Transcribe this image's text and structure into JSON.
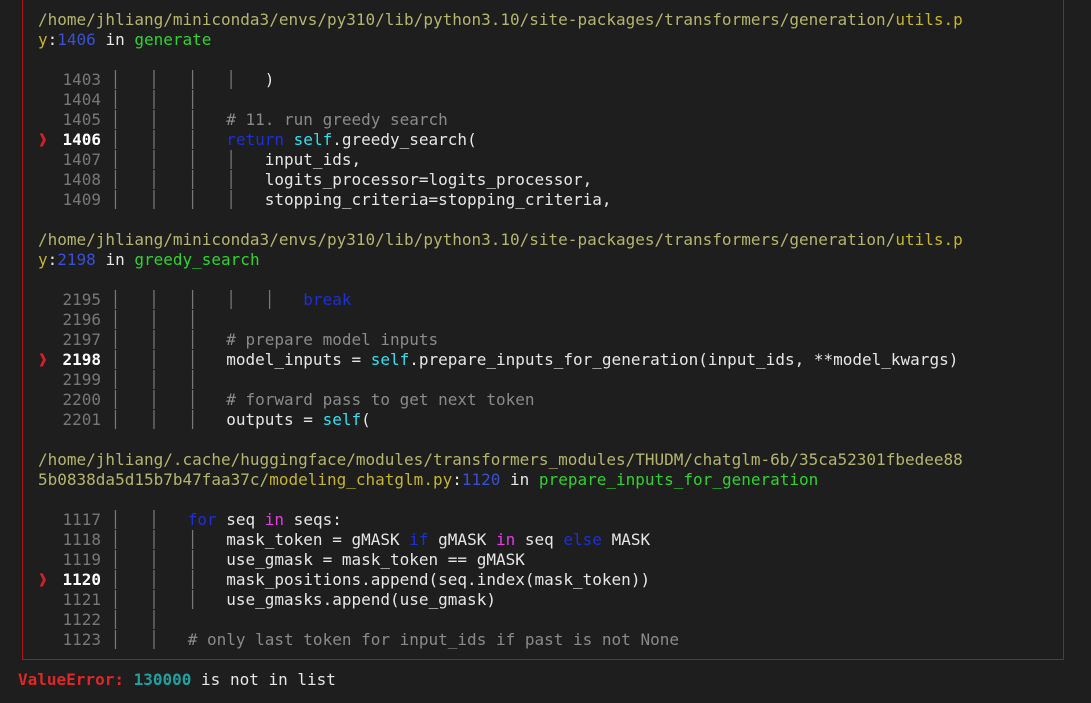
{
  "frames": [
    {
      "path_line1": "/home/jhliang/miniconda3/envs/py310/lib/python3.10/site-packages/transformers/generation/",
      "file_line1": "utils.p",
      "file_line2": "y",
      "colon": ":",
      "lineno": "1406",
      "in_word": " in ",
      "func": "generate",
      "lines": [
        {
          "n": "1403",
          "pipes": "│   │   │   │   ",
          "code": ")"
        },
        {
          "n": "1404",
          "pipes": "│   │   │   ",
          "code": ""
        },
        {
          "n": "1405",
          "pipes": "│   │   │   ",
          "comment": "# 11. run greedy search"
        },
        {
          "n": "1406",
          "pipes": "│   │   │   ",
          "kw": "return",
          "sp": " ",
          "self": "self",
          "code": ".greedy_search(",
          "current": true
        },
        {
          "n": "1407",
          "pipes": "│   │   │   │   ",
          "code": "input_ids,"
        },
        {
          "n": "1408",
          "pipes": "│   │   │   │   ",
          "code": "logits_processor=logits_processor,"
        },
        {
          "n": "1409",
          "pipes": "│   │   │   │   ",
          "code": "stopping_criteria=stopping_criteria,"
        }
      ]
    },
    {
      "path_line1": "/home/jhliang/miniconda3/envs/py310/lib/python3.10/site-packages/transformers/generation/",
      "file_line1": "utils.p",
      "file_line2": "y",
      "colon": ":",
      "lineno": "2198",
      "in_word": " in ",
      "func": "greedy_search",
      "lines": [
        {
          "n": "2195",
          "pipes": "│   │   │   │   │   ",
          "kw": "break"
        },
        {
          "n": "2196",
          "pipes": "│   │   │   ",
          "code": ""
        },
        {
          "n": "2197",
          "pipes": "│   │   │   ",
          "comment": "# prepare model inputs"
        },
        {
          "n": "2198",
          "pipes": "│   │   │   ",
          "code": "model_inputs = ",
          "self": "self",
          "code2": ".prepare_inputs_for_generation(input_ids, **model_kwargs)",
          "current": true
        },
        {
          "n": "2199",
          "pipes": "│   │   │   ",
          "code": ""
        },
        {
          "n": "2200",
          "pipes": "│   │   │   ",
          "comment": "# forward pass to get next token"
        },
        {
          "n": "2201",
          "pipes": "│   │   │   ",
          "code": "outputs = ",
          "self": "self",
          "code2": "("
        }
      ]
    },
    {
      "path_line1": "/home/jhliang/.cache/huggingface/modules/transformers_modules/THUDM/chatglm-6b/35ca52301fbedee88",
      "path_line2": "5b0838da5d15b7b47faa37c/",
      "file_line2": "modeling_chatglm.py",
      "colon": ":",
      "lineno": "1120",
      "in_word": " in ",
      "func": "prepare_inputs_for_generation",
      "lines": [
        {
          "n": "1117",
          "pipes": "│   │   ",
          "kw": "for",
          "code": " seq ",
          "in": "in",
          "code2": " seqs:"
        },
        {
          "n": "1118",
          "pipes": "│   │   │   ",
          "code": "mask_token = gMASK ",
          "kw": "if",
          "code2": " gMASK ",
          "in": "in",
          "code3": " seq ",
          "kw2": "else",
          "code4": " MASK"
        },
        {
          "n": "1119",
          "pipes": "│   │   │   ",
          "code": "use_gmask = mask_token == gMASK"
        },
        {
          "n": "1120",
          "pipes": "│   │   │   ",
          "code": "mask_positions.append(seq.index(mask_token))",
          "current": true
        },
        {
          "n": "1121",
          "pipes": "│   │   │   ",
          "code": "use_gmasks.append(use_gmask)"
        },
        {
          "n": "1122",
          "pipes": "│   │   ",
          "code": ""
        },
        {
          "n": "1123",
          "pipes": "│   │   ",
          "comment": "# only last token for input_ids if past is not None"
        }
      ]
    }
  ],
  "marker": "❱",
  "error": {
    "type": "ValueError:",
    "number": "130000",
    "message": " is not in list"
  }
}
